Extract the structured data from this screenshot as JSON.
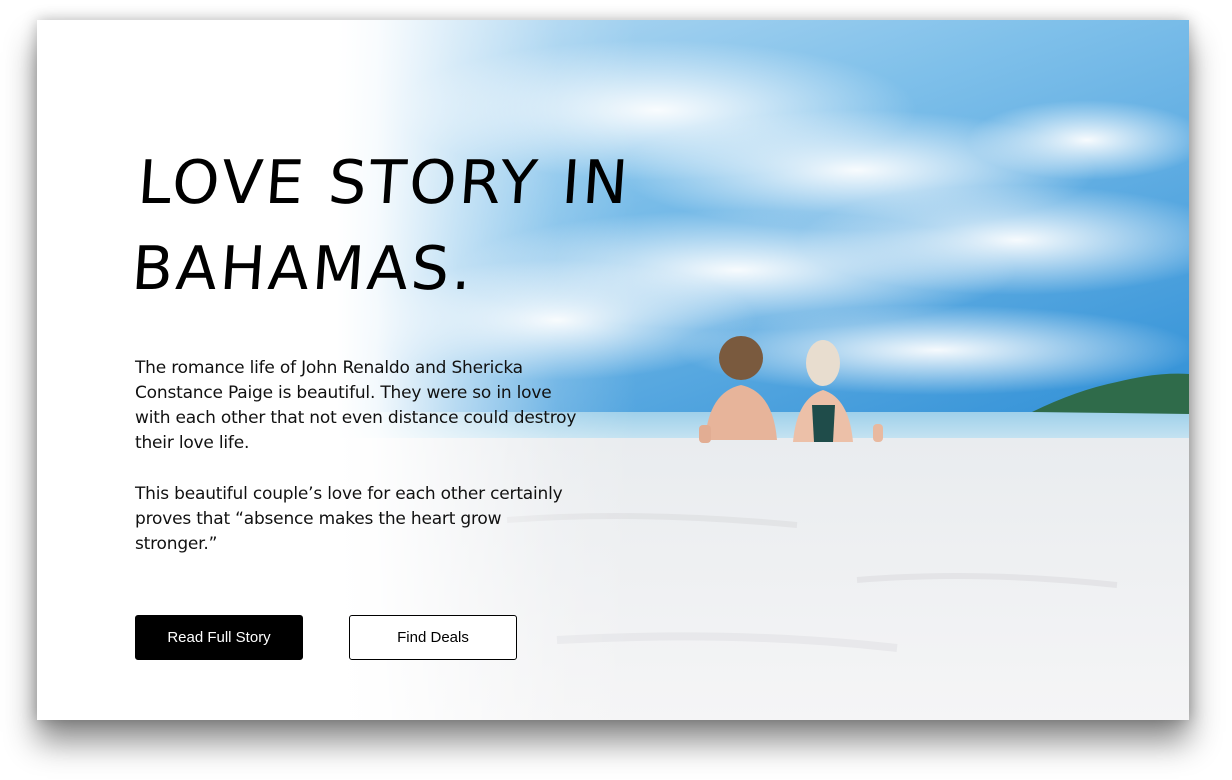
{
  "hero": {
    "title": "LOVE STORY IN BAHAMAS.",
    "paragraph_1": "The romance life of John Renaldo and Shericka Constance Paige is beautiful. They were so in love with each other that not even distance could destroy their love life.",
    "paragraph_2": "This beautiful couple’s love for each other certainly proves that “absence makes the heart grow stronger.”",
    "primary_button_label": "Read Full Story",
    "secondary_button_label": "Find Deals",
    "background_image": "beach-couple-photo"
  },
  "colors": {
    "primary_button_bg": "#000000",
    "primary_button_text": "#ffffff",
    "secondary_button_border": "#000000",
    "sky_blue": "#3c9fe0",
    "sand": "#f2f3f5"
  }
}
